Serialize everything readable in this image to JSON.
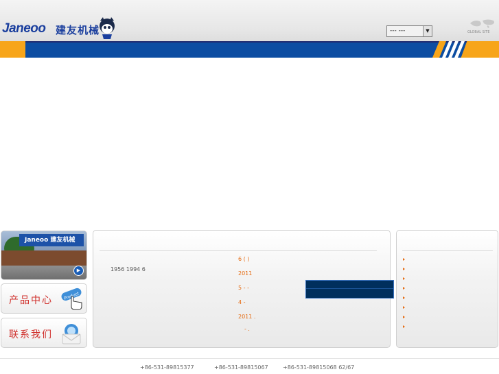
{
  "header": {
    "logo_text": "Janeoo",
    "logo_cn": "建友机械",
    "language_select": "--- ---",
    "global_site": "GLOBAL SITE"
  },
  "sidebar": {
    "photo_sign": "Janeoo 建友机械",
    "product_label": "产品中心",
    "product_icon_text": "Product",
    "contact_label": "联系我们"
  },
  "main": {
    "intro": "1956  1994 6",
    "news": [
      "6  (      )",
      "2011",
      "5      -      -",
      "4      -",
      "2011                .",
      "-  ."
    ]
  },
  "right": {
    "bullets": 8
  },
  "footer": {
    "phone1": "+86-531-89815377",
    "phone2": "+86-531-89815067",
    "phone3": "+86-531-89815068 62/67"
  },
  "colors": {
    "brand_blue": "#0c4da2",
    "accent_orange": "#f7a51a",
    "news_orange": "#e56a10",
    "label_red": "#d0312d"
  }
}
